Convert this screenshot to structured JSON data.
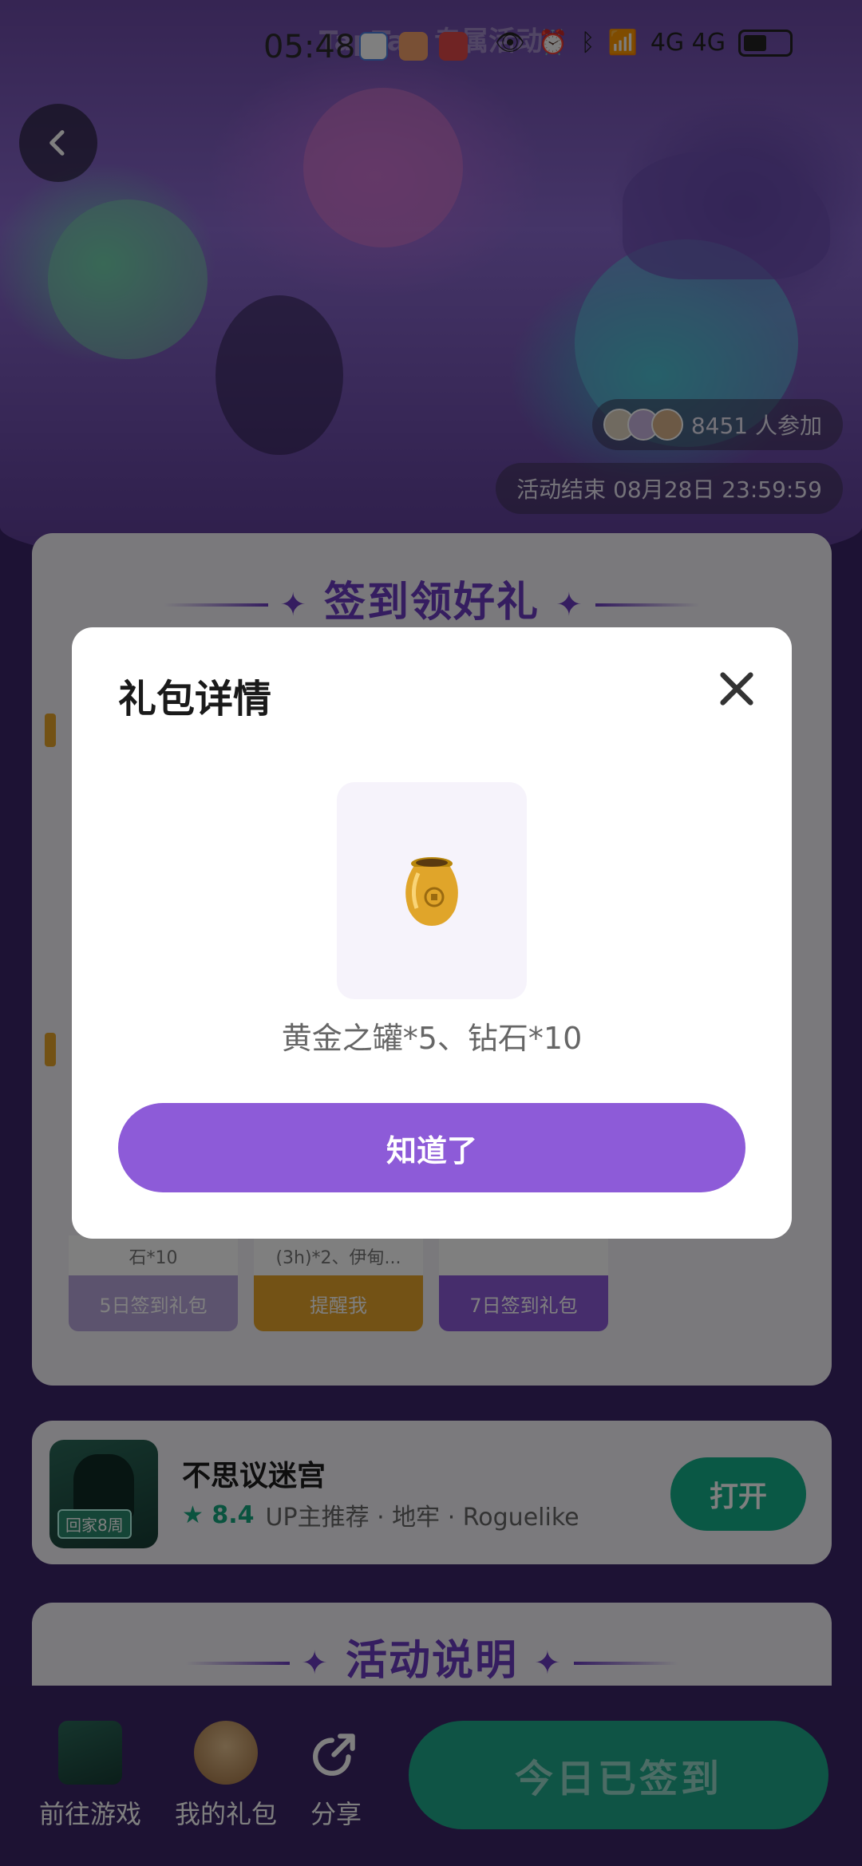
{
  "status_bar": {
    "time": "05:48",
    "network": "4G 4G"
  },
  "header": {
    "title": "TapTap 专属活动"
  },
  "banner": {
    "participants": "8451 人参加",
    "event_end": "活动结束 08月28日 23:59:59"
  },
  "signin": {
    "title": "签到领好礼",
    "slots": [
      {
        "reward_text": "石*10",
        "label": "5日签到礼包"
      },
      {
        "reward_text": "(3h)*2、伊甸...",
        "label": "提醒我"
      },
      {
        "reward_text": "",
        "label": "7日签到礼包"
      }
    ]
  },
  "game": {
    "name": "不思议迷宫",
    "rating": "8.4",
    "tags": "UP主推荐 · 地牢 · Roguelike",
    "icon_badge": "回家8周",
    "open_label": "打开"
  },
  "rules": {
    "title": "活动说明"
  },
  "bottom_bar": {
    "go_game": "前往游戏",
    "my_gifts": "我的礼包",
    "share": "分享",
    "signed_today": "今日已签到"
  },
  "modal": {
    "title": "礼包详情",
    "item_desc": "黄金之罐*5、钻石*10",
    "confirm_label": "知道了"
  },
  "colors": {
    "accent_purple": "#8d5bd8",
    "title_purple": "#6a3bc0",
    "teal": "#15b08a",
    "gold": "#e6a52a"
  }
}
